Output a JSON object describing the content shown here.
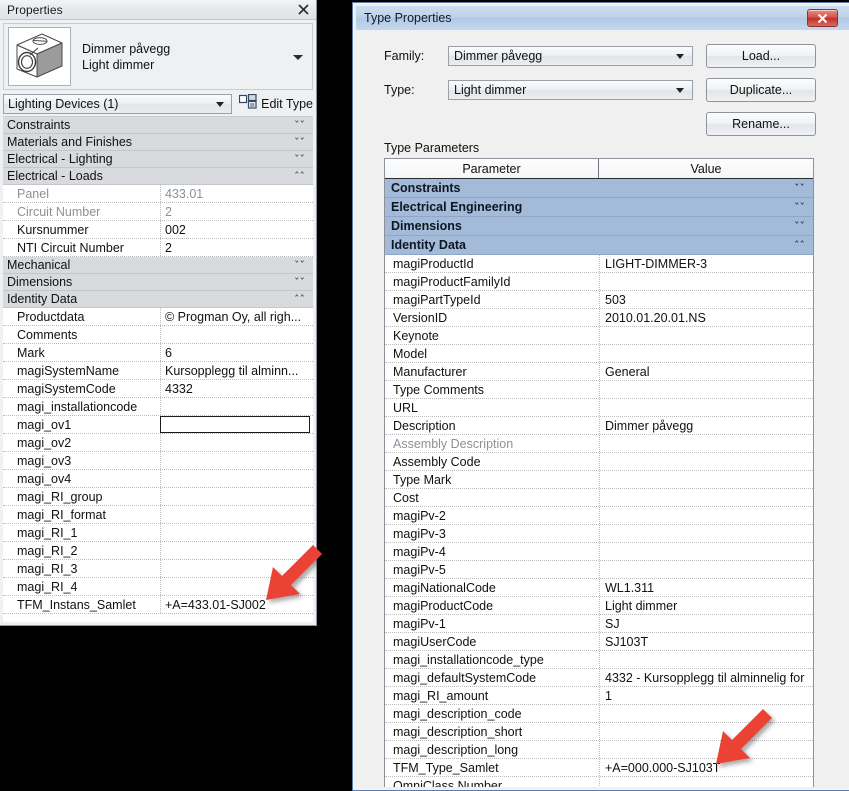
{
  "properties_palette": {
    "title": "Properties",
    "close_icon": "close-icon",
    "thumbnail_icon": "dimmer-device-thumbnail",
    "family_name": "Dimmer påvegg",
    "type_name": "Light dimmer",
    "header_caret_icon": "chevron-down-icon",
    "selector_value": "Lighting Devices (1)",
    "edit_type_label": "Edit Type",
    "edit_type_icon": "edit-type-icon",
    "groups": [
      {
        "label": "Constraints",
        "state": "collapsed",
        "chevron": "ˇˇ",
        "rows": []
      },
      {
        "label": "Materials and Finishes",
        "state": "collapsed",
        "chevron": "ˇˇ",
        "rows": []
      },
      {
        "label": "Electrical - Lighting",
        "state": "collapsed",
        "chevron": "ˇˇ",
        "rows": []
      },
      {
        "label": "Electrical - Loads",
        "state": "expanded",
        "chevron": "ˆˆ",
        "rows": [
          {
            "name": "Panel",
            "value": "433.01",
            "readonly": true,
            "editing": false
          },
          {
            "name": "Circuit Number",
            "value": "2",
            "readonly": true,
            "editing": false
          },
          {
            "name": "Kursnummer",
            "value": "002",
            "readonly": false,
            "editing": false
          },
          {
            "name": "NTI Circuit Number",
            "value": "2",
            "readonly": false,
            "editing": false
          }
        ]
      },
      {
        "label": "Mechanical",
        "state": "collapsed",
        "chevron": "ˇˇ",
        "rows": []
      },
      {
        "label": "Dimensions",
        "state": "collapsed",
        "chevron": "ˇˇ",
        "rows": []
      },
      {
        "label": "Identity Data",
        "state": "expanded",
        "chevron": "ˆˆ",
        "rows": [
          {
            "name": "Productdata",
            "value": "© Progman Oy, all righ...",
            "readonly": false,
            "editing": false
          },
          {
            "name": "Comments",
            "value": "",
            "readonly": false,
            "editing": false
          },
          {
            "name": "Mark",
            "value": "6",
            "readonly": false,
            "editing": false
          },
          {
            "name": "magiSystemName",
            "value": "Kursopplegg til alminn...",
            "readonly": false,
            "editing": false
          },
          {
            "name": "magiSystemCode",
            "value": "4332",
            "readonly": false,
            "editing": false
          },
          {
            "name": "magi_installationcode",
            "value": "",
            "readonly": false,
            "editing": false
          },
          {
            "name": "magi_ov1",
            "value": "",
            "readonly": false,
            "editing": true
          },
          {
            "name": "magi_ov2",
            "value": "",
            "readonly": false,
            "editing": false
          },
          {
            "name": "magi_ov3",
            "value": "",
            "readonly": false,
            "editing": false
          },
          {
            "name": "magi_ov4",
            "value": "",
            "readonly": false,
            "editing": false
          },
          {
            "name": "magi_RI_group",
            "value": "",
            "readonly": false,
            "editing": false
          },
          {
            "name": "magi_RI_format",
            "value": "",
            "readonly": false,
            "editing": false
          },
          {
            "name": "magi_RI_1",
            "value": "",
            "readonly": false,
            "editing": false
          },
          {
            "name": "magi_RI_2",
            "value": "",
            "readonly": false,
            "editing": false
          },
          {
            "name": "magi_RI_3",
            "value": "",
            "readonly": false,
            "editing": false
          },
          {
            "name": "magi_RI_4",
            "value": "",
            "readonly": false,
            "editing": false
          },
          {
            "name": "TFM_Instans_Samlet",
            "value": "+A=433.01-SJ002",
            "readonly": false,
            "editing": false
          }
        ]
      }
    ]
  },
  "type_properties_dialog": {
    "title": "Type Properties",
    "close_label": "✖",
    "close_icon": "close-icon",
    "family_label": "Family:",
    "family_value": "Dimmer påvegg",
    "type_label": "Type:",
    "type_value": "Light dimmer",
    "load_button": "Load...",
    "duplicate_button": "Duplicate...",
    "rename_button": "Rename...",
    "type_parameters_caption": "Type Parameters",
    "columns": [
      "Parameter",
      "Value"
    ],
    "groups": [
      {
        "label": "Constraints",
        "state": "collapsed",
        "chevron": "ˇˇ",
        "rows": []
      },
      {
        "label": "Electrical Engineering",
        "state": "collapsed",
        "chevron": "ˇˇ",
        "rows": []
      },
      {
        "label": "Dimensions",
        "state": "collapsed",
        "chevron": "ˇˇ",
        "rows": []
      },
      {
        "label": "Identity Data",
        "state": "expanded",
        "chevron": "ˆˆ",
        "rows": [
          {
            "name": "magiProductId",
            "value": "LIGHT-DIMMER-3",
            "readonly": false
          },
          {
            "name": "magiProductFamilyId",
            "value": "",
            "readonly": false
          },
          {
            "name": "magiPartTypeId",
            "value": "503",
            "readonly": false
          },
          {
            "name": "VersionID",
            "value": "2010.01.20.01.NS",
            "readonly": false
          },
          {
            "name": "Keynote",
            "value": "",
            "readonly": false
          },
          {
            "name": "Model",
            "value": "",
            "readonly": false
          },
          {
            "name": "Manufacturer",
            "value": "General",
            "readonly": false
          },
          {
            "name": "Type Comments",
            "value": "",
            "readonly": false
          },
          {
            "name": "URL",
            "value": "",
            "readonly": false
          },
          {
            "name": "Description",
            "value": "Dimmer påvegg",
            "readonly": false
          },
          {
            "name": "Assembly Description",
            "value": "",
            "readonly": true
          },
          {
            "name": "Assembly Code",
            "value": "",
            "readonly": false
          },
          {
            "name": "Type Mark",
            "value": "",
            "readonly": false
          },
          {
            "name": "Cost",
            "value": "",
            "readonly": false
          },
          {
            "name": "magiPv-2",
            "value": "",
            "readonly": false
          },
          {
            "name": "magiPv-3",
            "value": "",
            "readonly": false
          },
          {
            "name": "magiPv-4",
            "value": "",
            "readonly": false
          },
          {
            "name": "magiPv-5",
            "value": "",
            "readonly": false
          },
          {
            "name": "magiNationalCode",
            "value": "WL1.311",
            "readonly": false
          },
          {
            "name": "magiProductCode",
            "value": "Light dimmer",
            "readonly": false
          },
          {
            "name": "magiPv-1",
            "value": "SJ",
            "readonly": false
          },
          {
            "name": "magiUserCode",
            "value": "SJ103T",
            "readonly": false
          },
          {
            "name": "magi_installationcode_type",
            "value": "",
            "readonly": false
          },
          {
            "name": "magi_defaultSystemCode",
            "value": "4332 - Kursopplegg til alminnelig for",
            "readonly": false
          },
          {
            "name": "magi_RI_amount",
            "value": "1",
            "readonly": false
          },
          {
            "name": "magi_description_code",
            "value": "",
            "readonly": false
          },
          {
            "name": "magi_description_short",
            "value": "",
            "readonly": false
          },
          {
            "name": "magi_description_long",
            "value": "",
            "readonly": false
          },
          {
            "name": "TFM_Type_Samlet",
            "value": "+A=000.000-SJ103T",
            "readonly": false
          },
          {
            "name": "OmniClass Number",
            "value": "",
            "readonly": false
          }
        ]
      }
    ]
  },
  "annotations": {
    "arrow_color": "#ea4335",
    "arrow_left_name": "red-arrow-pointing-to-tfm-instans-samlet",
    "arrow_right_name": "red-arrow-pointing-to-tfm-type-samlet"
  }
}
